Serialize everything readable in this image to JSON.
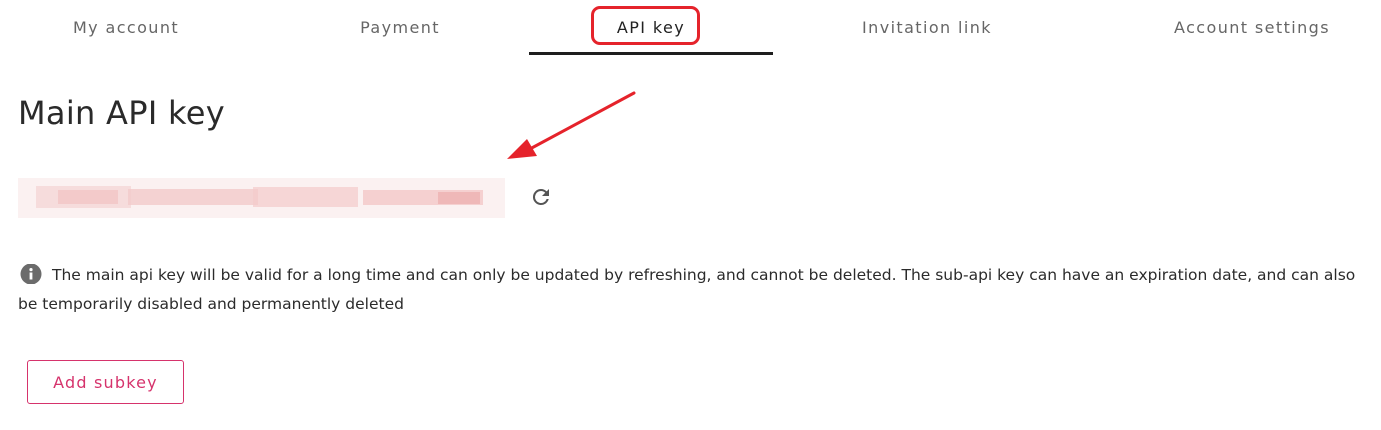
{
  "tabs": [
    {
      "label": "My account",
      "active": false
    },
    {
      "label": "Payment",
      "active": false
    },
    {
      "label": "API key",
      "active": true
    },
    {
      "label": "Invitation link",
      "active": false
    },
    {
      "label": "Account settings",
      "active": false
    }
  ],
  "main": {
    "title": "Main API key",
    "refresh_icon": "refresh-icon",
    "info_icon": "info-icon",
    "info_text": "The main api key will be valid for a long time and can only be updated by refreshing, and cannot be deleted. The sub-api key can have an expiration date, and can also be temporarily disabled and permanently deleted",
    "add_subkey_label": "Add subkey"
  },
  "colors": {
    "accent": "#d6336c",
    "annotation": "#e5232b",
    "active_tab_underline": "#1e1e1e"
  }
}
